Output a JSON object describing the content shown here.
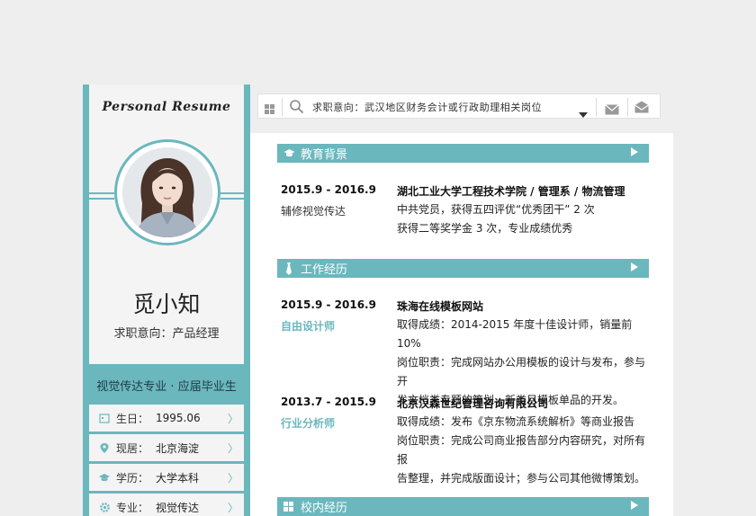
{
  "sidebar": {
    "script_title": "Personal Resume",
    "name": "觅小知",
    "intent": "求职意向：产品经理",
    "major_line": "视觉传达专业 · 应届毕业生",
    "info": [
      {
        "icon": "calendar-icon",
        "label": "生日：",
        "value": "1995.06"
      },
      {
        "icon": "location-pin-icon",
        "label": "现居：",
        "value": "北京海淀"
      },
      {
        "icon": "graduation-cap-icon",
        "label": "学历：",
        "value": "大学本科"
      },
      {
        "icon": "gear-icon",
        "label": "专业：",
        "value": "视觉传达"
      }
    ]
  },
  "search": {
    "text": "求职意向：武汉地区财务会计或行政助理相关岗位"
  },
  "education": {
    "title": "教育背景",
    "date": "2015.9 - 2016.9",
    "sub": "辅修视觉传达",
    "org": "湖北工业大学工程技术学院 / 管理系 / 物流管理",
    "lines": [
      "中共党员，获得五四评优“优秀团干”  2 次",
      "获得二等奖学金 3 次，专业成绩优秀"
    ]
  },
  "work": {
    "title": "工作经历",
    "jobs": [
      {
        "date": "2015.9 - 2016.9",
        "role": "自由设计师",
        "org": "珠海在线模板网站",
        "lines": [
          "取得成绩：2014-2015 年度十佳设计师，销量前 10%",
          "岗位职责：完成网站办公用模板的设计与发布，参与开",
          "发文档类专题的策划，新类目模板单品的开发。"
        ]
      },
      {
        "date": "2013.7 - 2015.9",
        "role": "行业分析师",
        "org": "北京汉森世纪管理咨询有限公司",
        "lines": [
          "取得成绩：发布《京东物流系统解析》等商业报告",
          "岗位职责：完成公司商业报告部分内容研究，对所有报",
          "告整理，并完成版面设计；参与公司其他微博策划。"
        ]
      }
    ]
  },
  "campus": {
    "title": "校内经历"
  },
  "colors": {
    "accent": "#6bb7be",
    "panel": "#f4f4f4",
    "background": "#eeeeee"
  }
}
